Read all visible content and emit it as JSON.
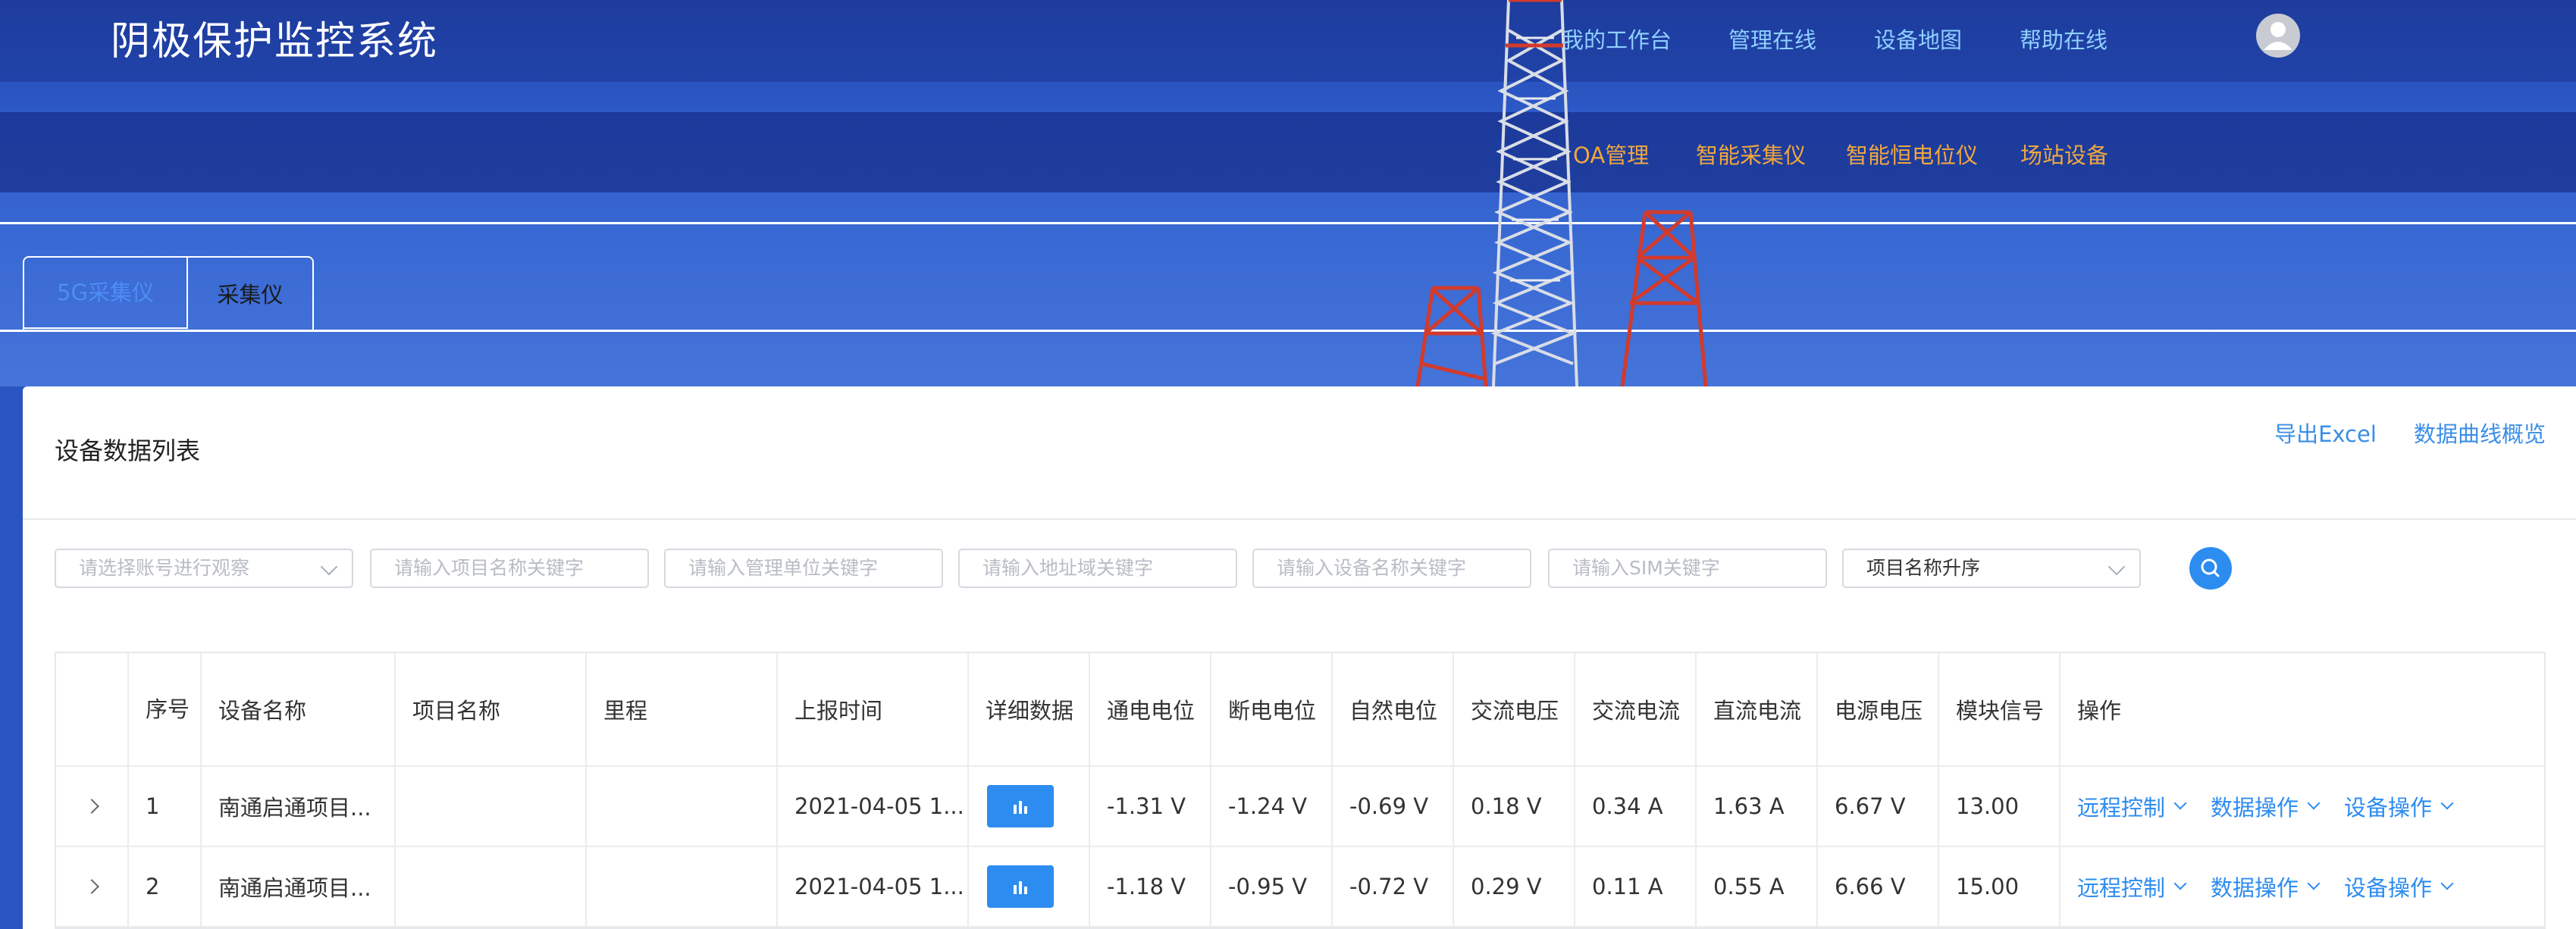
{
  "app": {
    "title": "阴极保护监控系统"
  },
  "top_nav": [
    "我的工作台",
    "管理在线",
    "设备地图",
    "帮助在线"
  ],
  "sub_nav": [
    "OA管理",
    "智能采集仪",
    "智能恒电位仪",
    "场站设备"
  ],
  "tabs": [
    "5G采集仪",
    "采集仪"
  ],
  "card": {
    "title": "设备数据列表",
    "actions": {
      "export": "导出Excel",
      "curves": "数据曲线概览"
    }
  },
  "filters": {
    "account_placeholder": "请选择账号进行观察",
    "project_placeholder": "请输入项目名称关键字",
    "unit_placeholder": "请输入管理单位关键字",
    "region_placeholder": "请输入地址域关键字",
    "device_placeholder": "请输入设备名称关键字",
    "sim_placeholder": "请输入SIM关键字",
    "sort_value": "项目名称升序"
  },
  "table": {
    "headers": [
      "序号",
      "设备名称",
      "项目名称",
      "里程",
      "上报时间",
      "详细数据",
      "通电电位",
      "断电电位",
      "自然电位",
      "交流电压",
      "交流电流",
      "直流电流",
      "电源电压",
      "模块信号",
      "操作"
    ],
    "rows": [
      {
        "no": "1",
        "device": "南通启通项目...",
        "project": "",
        "mileage": "",
        "time": "2021-04-05 1...",
        "on_potential": "-1.31 V",
        "off_potential": "-1.24 V",
        "natural_potential": "-0.69 V",
        "ac_voltage": "0.18 V",
        "ac_current": "0.34 A",
        "dc_current": "1.63 A",
        "supply_voltage": "6.67 V",
        "signal": "13.00"
      },
      {
        "no": "2",
        "device": "南通启通项目...",
        "project": "",
        "mileage": "",
        "time": "2021-04-05 1...",
        "on_potential": "-1.18 V",
        "off_potential": "-0.95 V",
        "natural_potential": "-0.72 V",
        "ac_voltage": "0.29 V",
        "ac_current": "0.11 A",
        "dc_current": "0.55 A",
        "supply_voltage": "6.66 V",
        "signal": "15.00"
      }
    ],
    "ops": [
      "远程控制",
      "数据操作",
      "设备操作"
    ]
  },
  "colors": {
    "accent": "#2d8cf0",
    "nav_link": "#8fd0ff",
    "sub_nav": "#f0a640",
    "header_bg": "#2d5ac8"
  }
}
